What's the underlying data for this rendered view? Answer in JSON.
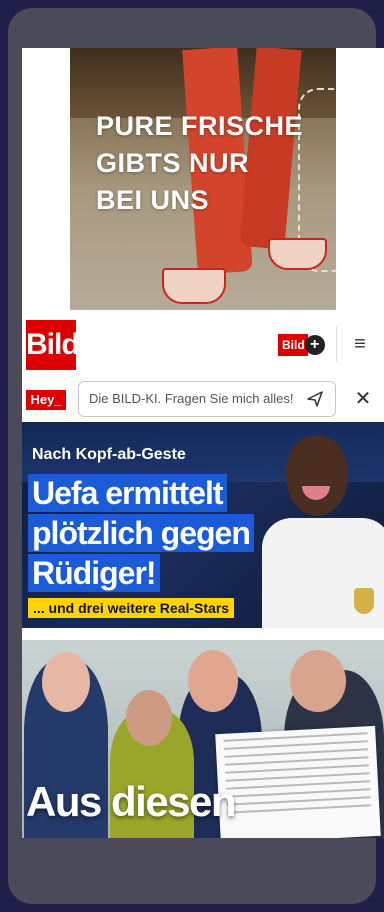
{
  "ad": {
    "headline": "PURE FRISCHE\nGIBTS NUR\nBEI UNS"
  },
  "header": {
    "logo": "Bild",
    "plus_label": "Bild",
    "plus_symbol": "+",
    "menu_icon": "≡"
  },
  "ki": {
    "badge": "Hey_",
    "placeholder": "Die BILD-KI. Fragen Sie mich alles!",
    "close": "✕"
  },
  "article1": {
    "kicker": "Nach Kopf-ab-Geste",
    "headline_lines": [
      "Uefa ermittelt",
      "plötzlich gegen",
      "Rüdiger!"
    ],
    "subline": "... und drei weitere Real-Stars"
  },
  "article2": {
    "headline": "Aus diesen"
  },
  "colors": {
    "bild_red": "#dd0000",
    "headline_blue": "#1a5bd6",
    "sub_yellow": "#ffd400"
  }
}
